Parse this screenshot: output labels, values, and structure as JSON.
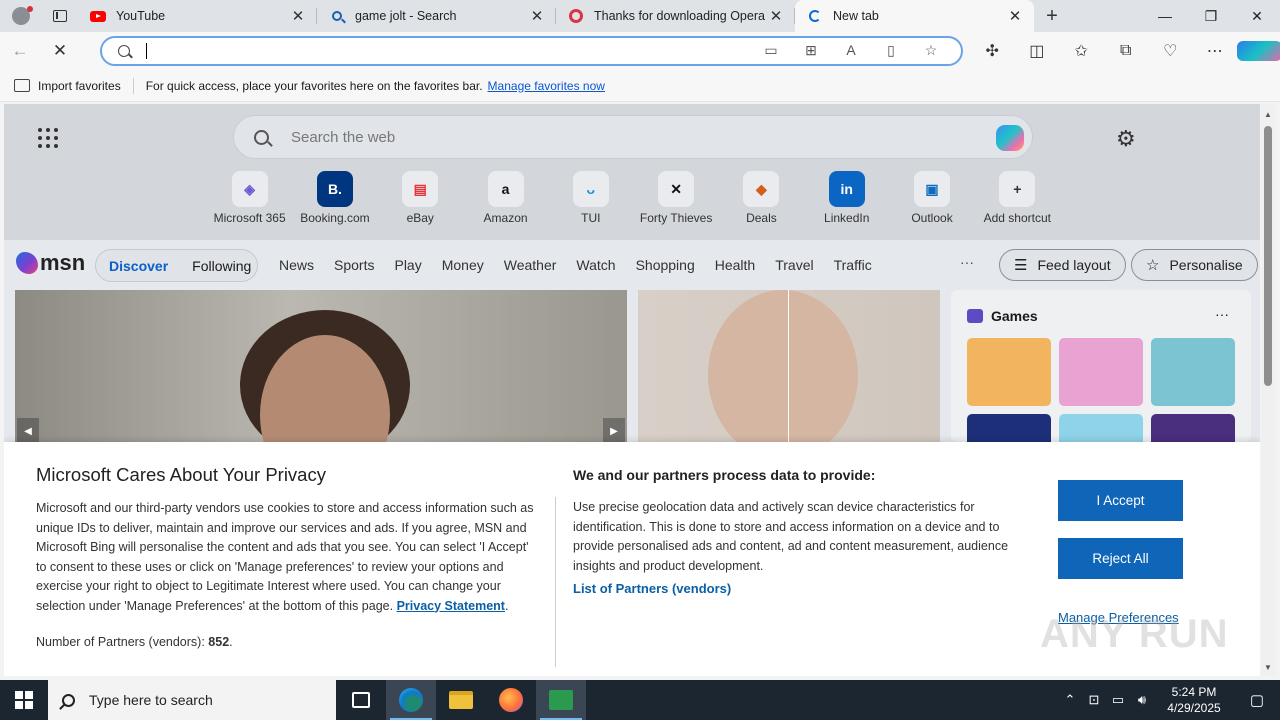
{
  "browser": {
    "tabs": [
      {
        "title": "YouTube",
        "icon": "youtube-icon"
      },
      {
        "title": "game jolt - Search",
        "icon": "search-icon"
      },
      {
        "title": "Thanks for downloading Opera",
        "icon": "opera-icon"
      },
      {
        "title": "New tab",
        "icon": "loading-icon",
        "active": true
      }
    ],
    "address": {
      "value": "",
      "placeholder": ""
    },
    "favorites_bar": {
      "import_label": "Import favorites",
      "hint": "For quick access, place your favorites here on the favorites bar.",
      "manage_link": "Manage favorites now"
    }
  },
  "ntp": {
    "search_placeholder": "Search the web",
    "shortcuts": [
      {
        "label": "Microsoft 365",
        "glyph": "◈",
        "color": "#6b5bd6"
      },
      {
        "label": "Booking.com",
        "glyph": "B.",
        "color": "#ffffff",
        "bg": "#003580"
      },
      {
        "label": "eBay",
        "glyph": "▤",
        "color": "#e53238"
      },
      {
        "label": "Amazon",
        "glyph": "a",
        "color": "#111111"
      },
      {
        "label": "TUI",
        "glyph": "ᴗ",
        "color": "#1b8fd6"
      },
      {
        "label": "Forty Thieves",
        "glyph": "✕",
        "color": "#111111"
      },
      {
        "label": "Deals",
        "glyph": "◆",
        "color": "#d35f1c"
      },
      {
        "label": "LinkedIn",
        "glyph": "in",
        "color": "#ffffff",
        "bg": "#0a66c2"
      },
      {
        "label": "Outlook",
        "glyph": "▣",
        "color": "#0f6cbd"
      },
      {
        "label": "Add shortcut",
        "glyph": "+",
        "color": "#333333"
      }
    ],
    "msn": {
      "logo": "msn",
      "pill": [
        "Discover",
        "Following"
      ],
      "categories": [
        "News",
        "Sports",
        "Play",
        "Money",
        "Weather",
        "Watch",
        "Shopping",
        "Health",
        "Travel",
        "Traffic"
      ],
      "feed_layout": "Feed layout",
      "personalise": "Personalise"
    },
    "games_title": "Games"
  },
  "privacy": {
    "title": "Microsoft Cares About Your Privacy",
    "body": "Microsoft and our third-party vendors use cookies to store and access information such as unique IDs to deliver, maintain and improve our services and ads. If you agree, MSN and Microsoft Bing will personalise the content and ads that you see. You can select 'I Accept' to consent to these uses or click on 'Manage preferences' to review your options and exercise your right to object to Legitimate Interest where used.  You can change your selection under 'Manage Preferences' at the bottom of this page.",
    "privacy_link": "Privacy Statement",
    "partners_count_label": "Number of Partners (vendors):",
    "partners_count": "852",
    "purposes_title": "We and our partners process data to provide:",
    "purposes_body": "Use precise geolocation data and actively scan device characteristics for identification. This is done to store and access information on a device and to provide personalised ads and content, ad and content measurement, audience insights and product development.",
    "partners_link": "List of Partners (vendors)",
    "accept": "I Accept",
    "reject": "Reject All",
    "manage": "Manage Preferences",
    "watermark": "ANY RUN"
  },
  "taskbar": {
    "search_placeholder": "Type here to search",
    "time": "5:24 PM",
    "date": "4/29/2025"
  }
}
